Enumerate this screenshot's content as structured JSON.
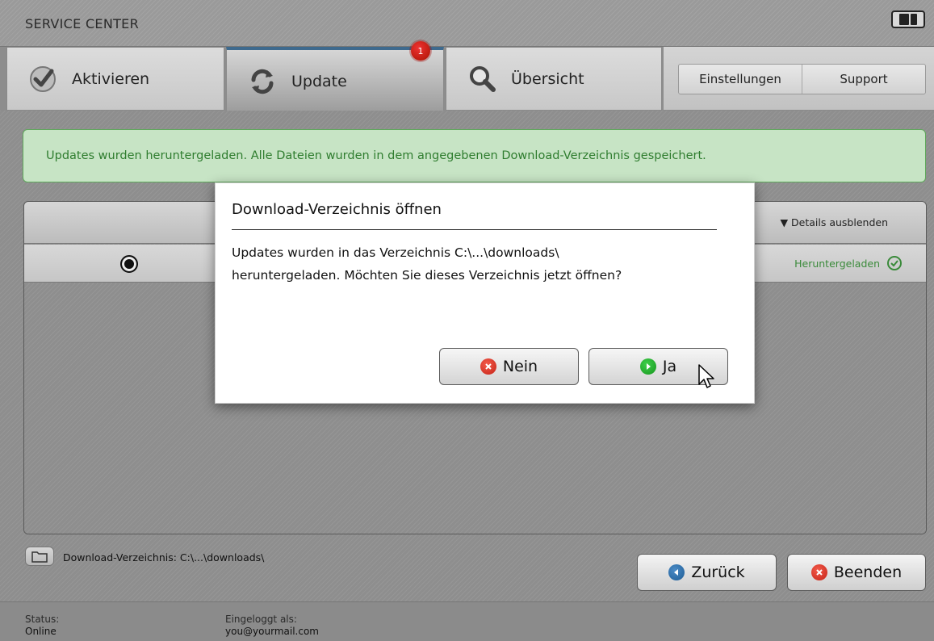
{
  "app": {
    "title": "SERVICE CENTER"
  },
  "tabs": [
    {
      "label": "Aktivieren"
    },
    {
      "label": "Update",
      "badge": "1"
    },
    {
      "label": "Übersicht"
    }
  ],
  "settings": {
    "settings_label": "Einstellungen",
    "support_label": "Support"
  },
  "banner": {
    "text": "Updates wurden heruntergeladen. Alle Dateien wurden in dem angegebenen Download-Verzeichnis gespeichert."
  },
  "list": {
    "details_toggle": "▼ Details ausblenden",
    "row_status": "Heruntergeladen"
  },
  "dialog": {
    "title": "Download-Verzeichnis öffnen",
    "message_line1": "Updates wurden in das Verzeichnis C:\\...\\downloads\\",
    "message_line2": "heruntergeladen. Möchten Sie dieses Verzeichnis jetzt öffnen?",
    "no_label": "Nein",
    "yes_label": "Ja"
  },
  "footer": {
    "download_dir": "Download-Verzeichnis: C:\\...\\downloads\\",
    "back_label": "Zurück",
    "quit_label": "Beenden"
  },
  "statusbar": {
    "status_label": "Status:",
    "status_value": "Online",
    "login_label": "Eingeloggt als:",
    "login_value": "you@yourmail.com"
  },
  "colors": {
    "accent_blue": "#3e6a8e",
    "success_green": "#2f7d2f",
    "banner_bg": "#c7e4c5",
    "badge_red": "#cc2211"
  },
  "icons": [
    "checkmark-icon",
    "refresh-icon",
    "magnifier-icon",
    "folder-icon",
    "check-circle-icon",
    "close-circle-icon",
    "play-circle-icon",
    "back-circle-icon",
    "cursor-icon",
    "ni-logo-icon"
  ]
}
